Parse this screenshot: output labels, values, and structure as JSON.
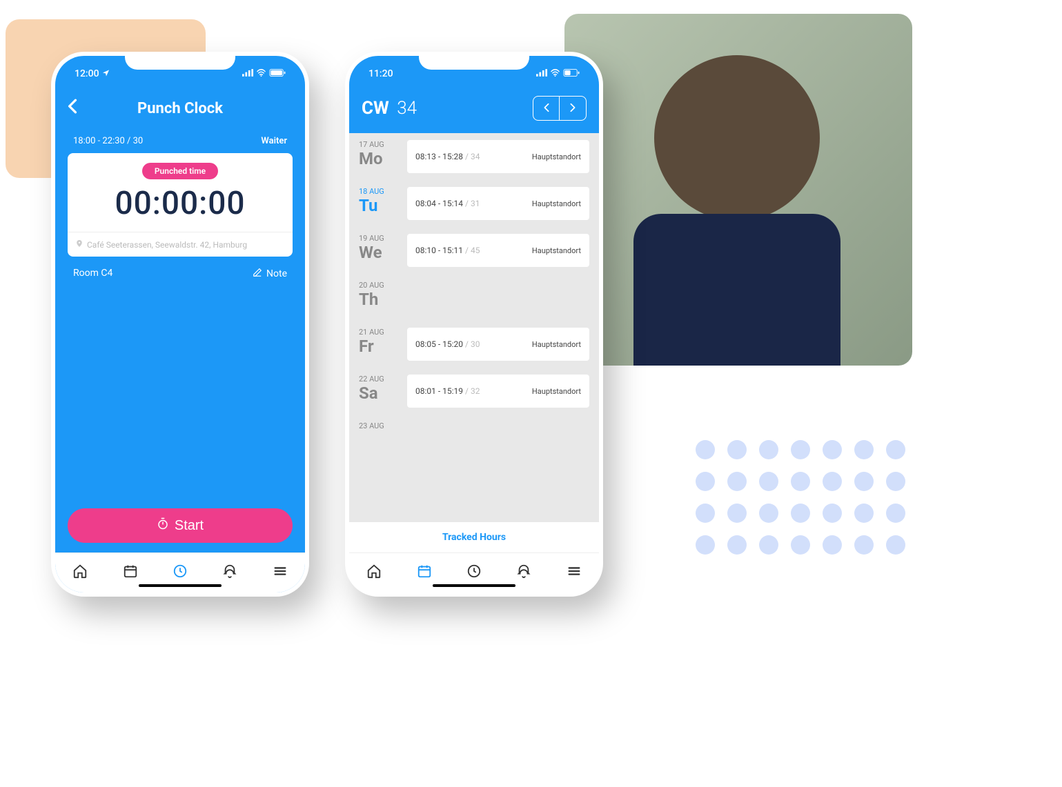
{
  "phone1": {
    "status_time": "12:00",
    "title": "Punch Clock",
    "shift_time": "18:00 - 22:30 / 30",
    "role": "Waiter",
    "badge": "Punched time",
    "timer": "00:00:00",
    "location": "Café Seeterassen, Seewaldstr. 42, Hamburg",
    "room": "Room C4",
    "note_label": "Note",
    "start_label": "Start"
  },
  "phone2": {
    "status_time": "11:20",
    "cw_label": "CW",
    "cw_num": "34",
    "footer": "Tracked Hours",
    "days": [
      {
        "date": "17 AUG",
        "short": "Mo",
        "active": false,
        "time": "08:13 - 15:28",
        "break": "/ 34",
        "loc": "Hauptstandort"
      },
      {
        "date": "18 AUG",
        "short": "Tu",
        "active": true,
        "time": "08:04 - 15:14",
        "break": "/ 31",
        "loc": "Hauptstandort"
      },
      {
        "date": "19 AUG",
        "short": "We",
        "active": false,
        "time": "08:10 - 15:11",
        "break": "/ 45",
        "loc": "Hauptstandort"
      },
      {
        "date": "20 AUG",
        "short": "Th",
        "active": false,
        "time": "",
        "break": "",
        "loc": ""
      },
      {
        "date": "21 AUG",
        "short": "Fr",
        "active": false,
        "time": "08:05 - 15:20",
        "break": "/ 30",
        "loc": "Hauptstandort"
      },
      {
        "date": "22 AUG",
        "short": "Sa",
        "active": false,
        "time": "08:01 - 15:19",
        "break": "/ 32",
        "loc": "Hauptstandort"
      },
      {
        "date": "23 AUG",
        "short": "",
        "active": false,
        "time": "",
        "break": "",
        "loc": ""
      }
    ]
  }
}
